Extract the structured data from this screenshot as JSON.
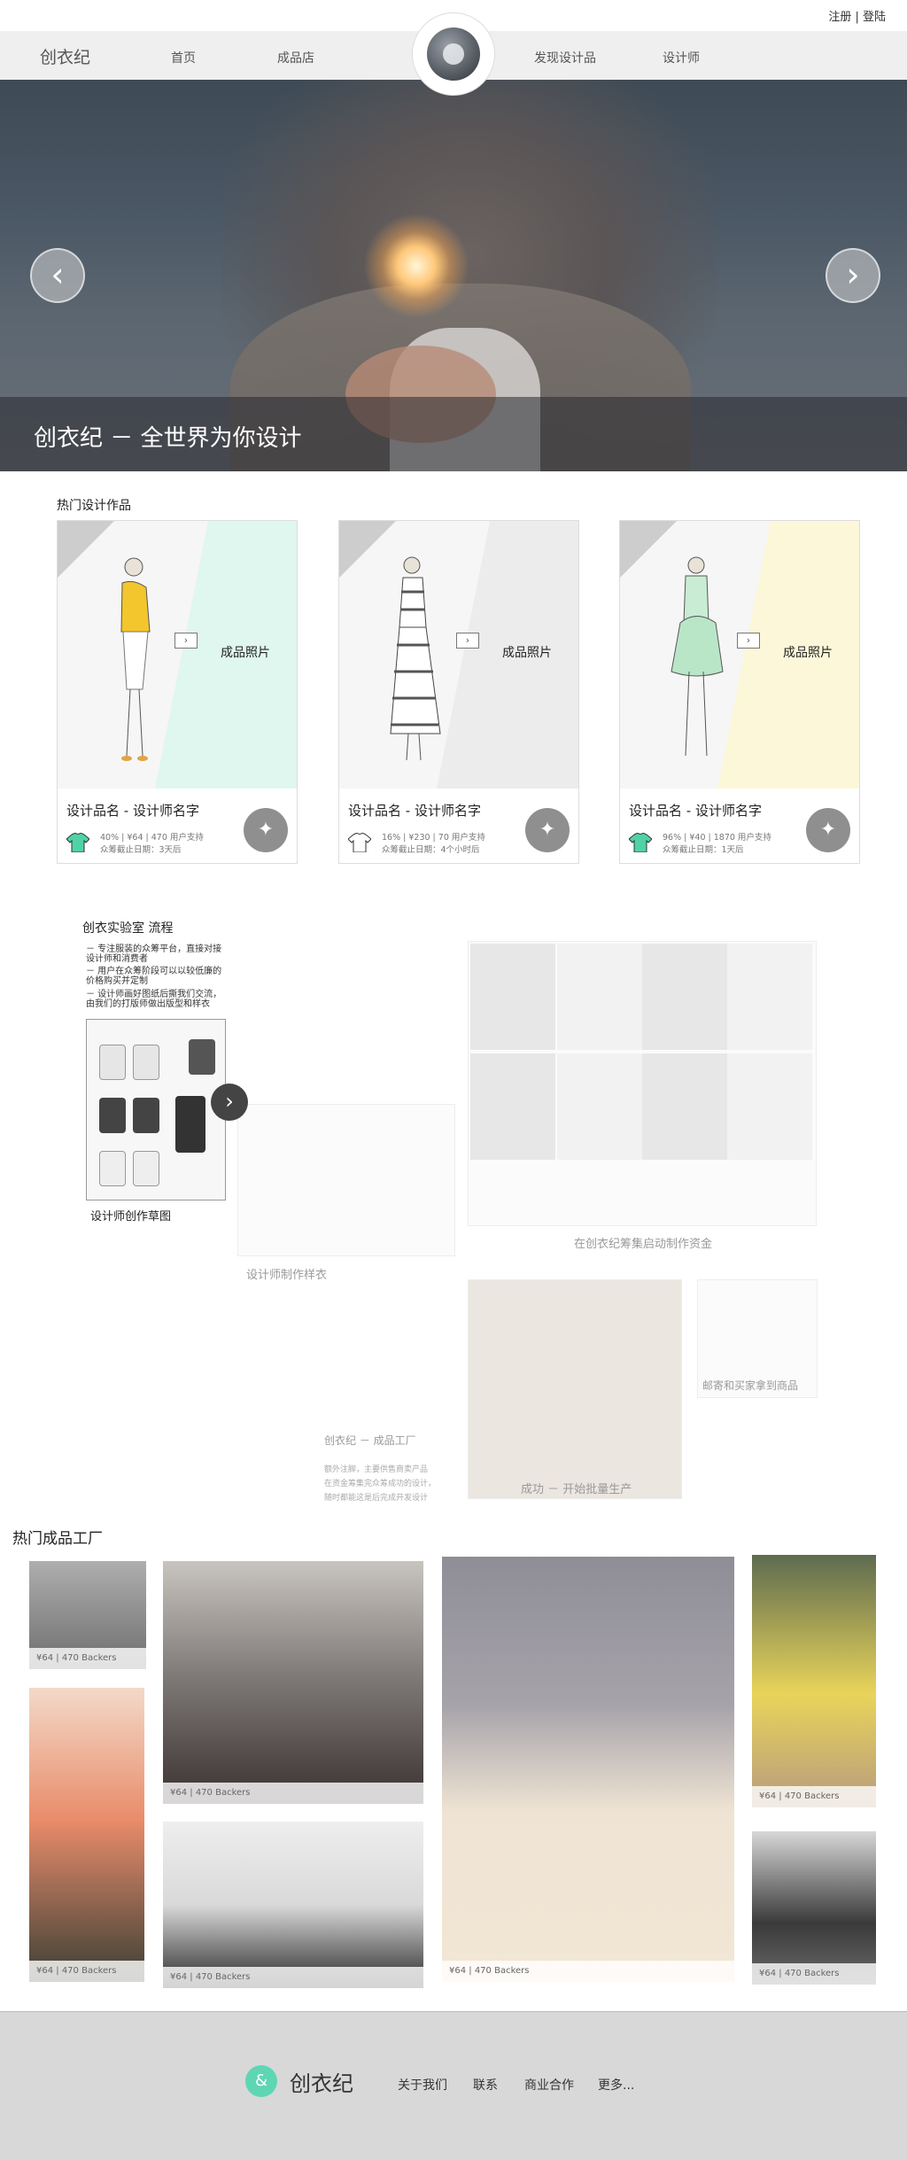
{
  "header": {
    "auth_text": "注册 | 登陆",
    "brand": "创衣纪",
    "nav": [
      "首页",
      "成品店",
      "发现设计品",
      "设计师"
    ]
  },
  "hero": {
    "caption": "创衣纪 － 全世界为你设计",
    "prev_icon": "chevron-left-icon",
    "next_icon": "chevron-right-icon"
  },
  "hot_designs": {
    "title": "热门设计作品",
    "cards": [
      {
        "name": "设计品名 - 设计师名字",
        "photo_label": "成品照片",
        "stats": "40% | ¥64 | 470 用户支持",
        "deadline": "众筹截止日期：3天后",
        "accent": "#dff7ee",
        "tee_color": "#4fd2a7"
      },
      {
        "name": "设计品名 - 设计师名字",
        "photo_label": "成品照片",
        "stats": "16% | ¥230 | 70 用户支持",
        "deadline": "众筹截止日期：4个小时后",
        "accent": "#ececec",
        "tee_color": "#ffffff"
      },
      {
        "name": "设计品名 - 设计师名字",
        "photo_label": "成品照片",
        "stats": "96% | ¥40 | 1870 用户支持",
        "deadline": "众筹截止日期：1天后",
        "accent": "#fcf7d8",
        "tee_color": "#4fd2a7"
      }
    ]
  },
  "process": {
    "title": "创衣实验室 流程",
    "desc": [
      "－ 专注服装的众筹平台，直接对接设计师和消费者",
      "－ 用户在众筹阶段可以以较低廉的价格购买并定制",
      "－ 设计师画好图纸后撕我们交流，由我们的打版师做出版型和样衣"
    ],
    "step1": "设计师创作草图",
    "step2": "设计师制作样衣",
    "step3": "在创衣纪筹集启动制作资金",
    "step4_title": "创衣纪 － 成品工厂",
    "step4_desc": [
      "额外注脚，主要供售商卖产品",
      "在资金筹集完众筹成功的设计，",
      "随时都能这是后完成开发设计"
    ],
    "step5": "成功 － 开始批量生产",
    "step6": "邮寄和买家拿到商品"
  },
  "factory": {
    "title": "热门成品工厂",
    "badge": "¥64 | 470 Backers"
  },
  "footer": {
    "logo_glyph": "&",
    "brand": "创衣纪",
    "links": [
      "关于我们",
      "联系",
      "商业合作",
      "更多..."
    ]
  }
}
